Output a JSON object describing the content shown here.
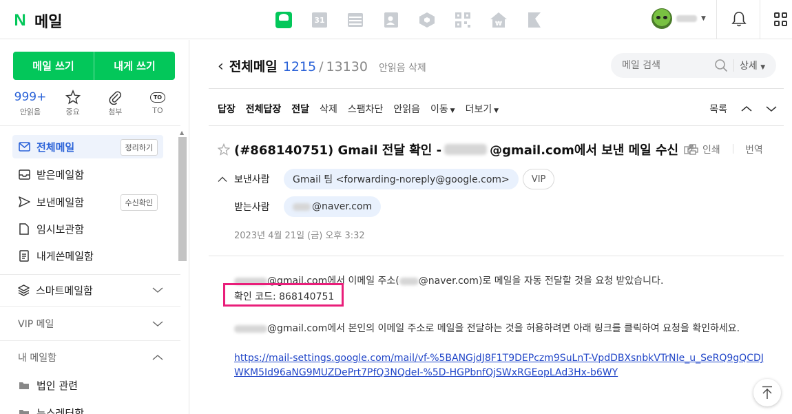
{
  "brand": {
    "logo_letter": "N",
    "title": "메일"
  },
  "top_apps": [
    {
      "icon": "mail-app-icon"
    },
    {
      "icon": "calendar-app-icon",
      "label": "31"
    },
    {
      "icon": "table-app-icon"
    },
    {
      "icon": "contacts-app-icon"
    },
    {
      "icon": "box-app-icon"
    },
    {
      "icon": "qr-app-icon"
    },
    {
      "icon": "home-app-icon"
    },
    {
      "icon": "flag-app-icon"
    }
  ],
  "compose": {
    "write": "메일 쓰기",
    "write_self": "내게 쓰기"
  },
  "quick": {
    "unread": {
      "value": "999+",
      "label": "안읽음"
    },
    "important": {
      "label": "중요"
    },
    "attach": {
      "label": "첨부"
    },
    "to": {
      "icon_text": "TO",
      "label": "TO"
    }
  },
  "folders": [
    {
      "label": "전체메일",
      "chip": "정리하기"
    },
    {
      "label": "받은메일함"
    },
    {
      "label": "보낸메일함",
      "chip": "수신확인"
    },
    {
      "label": "임시보관함"
    },
    {
      "label": "내게쓴메일함"
    }
  ],
  "groups": {
    "smart": "스마트메일함",
    "vip": "VIP 메일",
    "mine": "내 메일함"
  },
  "my_folders": [
    "법인 관련",
    "뉴스레터함"
  ],
  "mailbox": {
    "title": "전체메일",
    "unread": "1215",
    "sep": "/",
    "total": "13130",
    "delete_unread": "안읽음 삭제"
  },
  "search": {
    "placeholder": "메일 검색",
    "detail": "상세"
  },
  "toolbar": {
    "reply": "답장",
    "reply_all": "전체답장",
    "forward": "전달",
    "delete": "삭제",
    "spam": "스팸차단",
    "unread": "안읽음",
    "move": "이동",
    "more": "더보기",
    "list": "목록"
  },
  "message": {
    "subject_prefix": "(#868140751) Gmail 전달 확인 -",
    "subject_suffix": "@gmail.com에서 보낸 메일 수신",
    "print": "인쇄",
    "translate": "번역",
    "from_label": "보낸사람",
    "from_value": "Gmail 팀 <forwarding-noreply@google.com>",
    "vip": "VIP",
    "to_label": "받는사람",
    "to_suffix": "@naver.com",
    "date": "2023년 4월 21일 (금) 오후 3:32",
    "line1_a": "@gmail.com에서 이메일 주소(",
    "line1_b": "@naver.com)로 메일을 자동 전달할 것을 요청 받았습니다.",
    "code_line": "확인 코드: 868140751",
    "line3": "@gmail.com에서 본인의 이메일 주소로 메일을 전달하는 것을 허용하려면 아래 링크를 클릭하여 요청을 확인하세요.",
    "link": "https://mail-settings.google.com/mail/vf-%5BANGjdJ8F1T9DEPczm9SuLnT-VpdDBXsnbkVTrNIe_u_SeRQ9gQCDJWKM5Id96aNG9MUZDePrt7PfQ3NQdeI-%5D-HGPbnfQjSWxRGEopLAd3Hx-b6WY"
  },
  "colors": {
    "brand": "#03c75a",
    "accent": "#2a62d8",
    "highlight": "#e91e7a"
  }
}
